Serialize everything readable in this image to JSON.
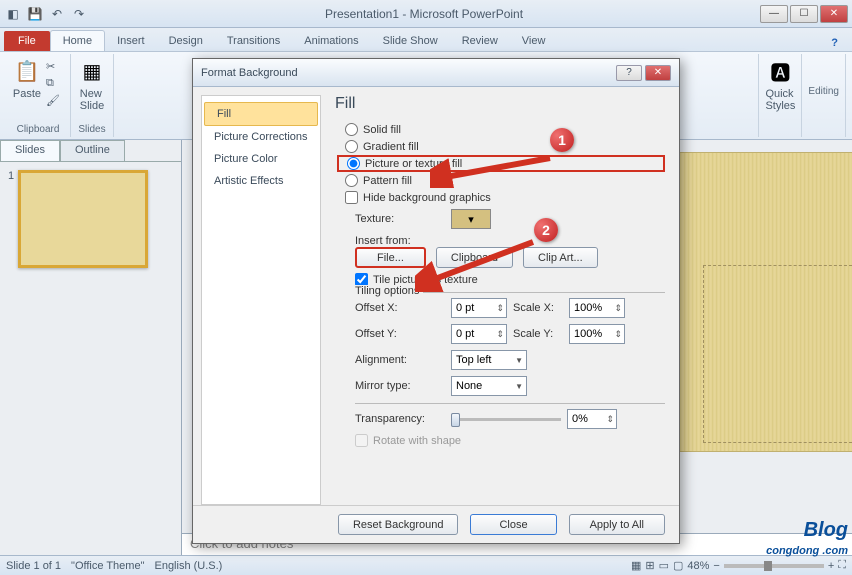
{
  "titlebar": {
    "title": "Presentation1 - Microsoft PowerPoint"
  },
  "ribbon": {
    "file": "File",
    "tabs": [
      "Home",
      "Insert",
      "Design",
      "Transitions",
      "Animations",
      "Slide Show",
      "Review",
      "View"
    ],
    "active": "Home",
    "groups": {
      "clipboard": {
        "label": "Clipboard",
        "paste": "Paste"
      },
      "slides": {
        "label": "Slides",
        "new_slide": "New\nSlide"
      },
      "drawing": {
        "quick_styles": "Quick\nStyles"
      },
      "editing": {
        "label": "Editing"
      }
    }
  },
  "pane": {
    "tabs": [
      "Slides",
      "Outline"
    ],
    "active": "Slides",
    "slide_num": "1"
  },
  "notes": {
    "placeholder": "Click to add notes"
  },
  "status": {
    "slide": "Slide 1 of 1",
    "theme": "\"Office Theme\"",
    "lang": "English (U.S.)",
    "zoom": "48%"
  },
  "dialog": {
    "title": "Format Background",
    "sidebar": [
      "Fill",
      "Picture Corrections",
      "Picture Color",
      "Artistic Effects"
    ],
    "heading": "Fill",
    "radios": {
      "solid": "Solid fill",
      "gradient": "Gradient fill",
      "picture": "Picture or texture fill",
      "pattern": "Pattern fill"
    },
    "hide_bg": "Hide background graphics",
    "texture_lbl": "Texture:",
    "insert_lbl": "Insert from:",
    "file_btn": "File...",
    "clipboard_btn": "Clipboard",
    "clipart_btn": "Clip Art...",
    "tile_chk": "Tile picture as texture",
    "tiling_lbl": "Tiling options",
    "offx": "Offset X:",
    "offx_v": "0 pt",
    "offy": "Offset Y:",
    "offy_v": "0 pt",
    "scx": "Scale X:",
    "scx_v": "100%",
    "scy": "Scale Y:",
    "scy_v": "100%",
    "align": "Alignment:",
    "align_v": "Top left",
    "mirror": "Mirror type:",
    "mirror_v": "None",
    "trans": "Transparency:",
    "trans_v": "0%",
    "rotate": "Rotate with shape",
    "reset": "Reset Background",
    "close": "Close",
    "apply": "Apply to All"
  },
  "annot": {
    "b1": "1",
    "b2": "2"
  },
  "watermark": {
    "brand": "Blog",
    "sub": "congdong .com"
  }
}
